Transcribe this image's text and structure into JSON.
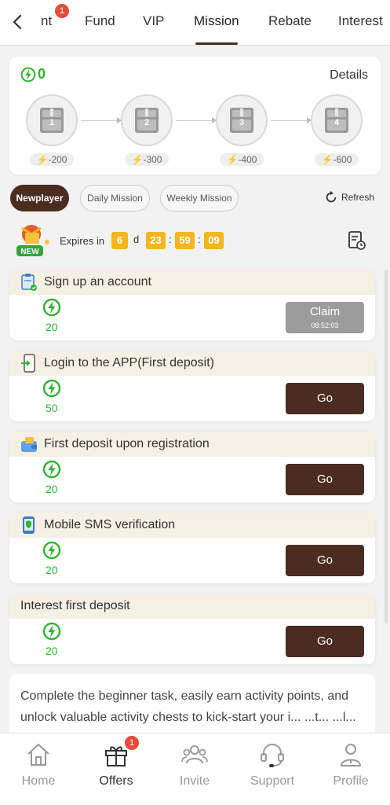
{
  "tabs": {
    "items": [
      {
        "label": "nt",
        "active": false
      },
      {
        "label": "Fund",
        "active": false
      },
      {
        "label": "VIP",
        "active": false
      },
      {
        "label": "Mission",
        "active": true
      },
      {
        "label": "Rebate",
        "active": false
      },
      {
        "label": "Interest",
        "active": false
      }
    ],
    "event_badge": "1"
  },
  "progress": {
    "points": "0",
    "details_label": "Details",
    "chests": [
      {
        "number": "1",
        "requirement": "-200"
      },
      {
        "number": "2",
        "requirement": "-300"
      },
      {
        "number": "3",
        "requirement": "-400"
      },
      {
        "number": "4",
        "requirement": "-600"
      }
    ]
  },
  "mission_types": {
    "newplayer": "Newplayer",
    "daily": "Daily Mission",
    "weekly": "Weekly Mission",
    "active": "Newplayer",
    "refresh_label": "Refresh"
  },
  "expiry": {
    "label": "Expires in",
    "days": "6",
    "day_unit": "d",
    "hours": "23",
    "minutes": "59",
    "seconds": "09",
    "sep": ":",
    "new_badge": "NEW"
  },
  "missions": [
    {
      "title": "Sign up an account",
      "points": "20",
      "button": "Claim",
      "button_sub": "08:52:03",
      "icon": "clipboard-icon"
    },
    {
      "title": "Login to the APP(First deposit)",
      "points": "50",
      "button": "Go",
      "icon": "phone-login-icon"
    },
    {
      "title": "First deposit upon registration",
      "points": "20",
      "button": "Go",
      "icon": "wallet-icon"
    },
    {
      "title": "Mobile SMS verification",
      "points": "20",
      "button": "Go",
      "icon": "mobile-shield-icon"
    },
    {
      "title": "Interest first deposit",
      "points": "20",
      "button": "Go",
      "icon": ""
    }
  ],
  "description": "Complete the beginner task, easily earn activity points, and unlock valuable activity chests to kick-start your i... ...t... ...l... ... ...l... ...",
  "bottom_nav": {
    "items": [
      {
        "label": "Home",
        "icon": "home-icon"
      },
      {
        "label": "Offers",
        "icon": "gift-icon",
        "active": true
      },
      {
        "label": "Invite",
        "icon": "users-icon"
      },
      {
        "label": "Support",
        "icon": "headset-icon"
      },
      {
        "label": "Profile",
        "icon": "person-icon"
      }
    ],
    "offers_badge": "1"
  },
  "colors": {
    "brand_dark": "#4a2c20",
    "points_green": "#2fb52f",
    "timer_orange": "#f5b51d",
    "badge_red": "#e84b3a",
    "claim_grey": "#9c9c9c"
  }
}
